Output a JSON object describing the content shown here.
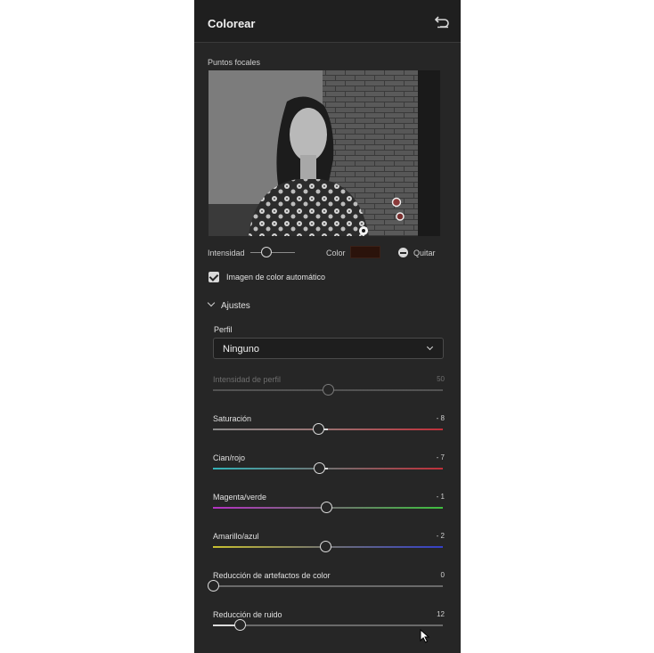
{
  "header": {
    "title": "Colorear"
  },
  "focal_points": {
    "label": "Puntos focales"
  },
  "controls": {
    "intensity_label": "Intensidad",
    "color_label": "Color",
    "color_value": "#2b130b",
    "remove_label": "Quitar"
  },
  "auto_color": {
    "label": "Imagen de color automático",
    "checked": true
  },
  "adjustments": {
    "section_label": "Ajustes",
    "profile_label": "Perfil",
    "profile_value": "Ninguno",
    "sliders": [
      {
        "label": "Intensidad de perfil",
        "value": "50",
        "min": 0,
        "max": 100,
        "level": 50,
        "enabled": false
      },
      {
        "label": "Saturación",
        "value": "- 8",
        "min": -100,
        "max": 100,
        "level": -8,
        "enabled": true
      },
      {
        "label": "Cian/rojo",
        "value": "- 7",
        "min": -100,
        "max": 100,
        "level": -7,
        "enabled": true
      },
      {
        "label": "Magenta/verde",
        "value": "- 1",
        "min": -100,
        "max": 100,
        "level": -1,
        "enabled": true
      },
      {
        "label": "Amarillo/azul",
        "value": "- 2",
        "min": -100,
        "max": 100,
        "level": -2,
        "enabled": true
      },
      {
        "label": "Reducción de artefactos de color",
        "value": "0",
        "min": 0,
        "max": 100,
        "level": 0,
        "enabled": true
      },
      {
        "label": "Reducción de ruido",
        "value": "12",
        "min": 0,
        "max": 100,
        "level": 12,
        "enabled": true
      }
    ]
  },
  "colors": {
    "panel_bg": "#262626",
    "header_bg": "#1f1f1f",
    "red": "#c0303a",
    "cyan": "#33b3b8",
    "magenta": "#b531c4",
    "green": "#3fbf3f",
    "yellow": "#c8c030",
    "blue": "#3440c8"
  }
}
